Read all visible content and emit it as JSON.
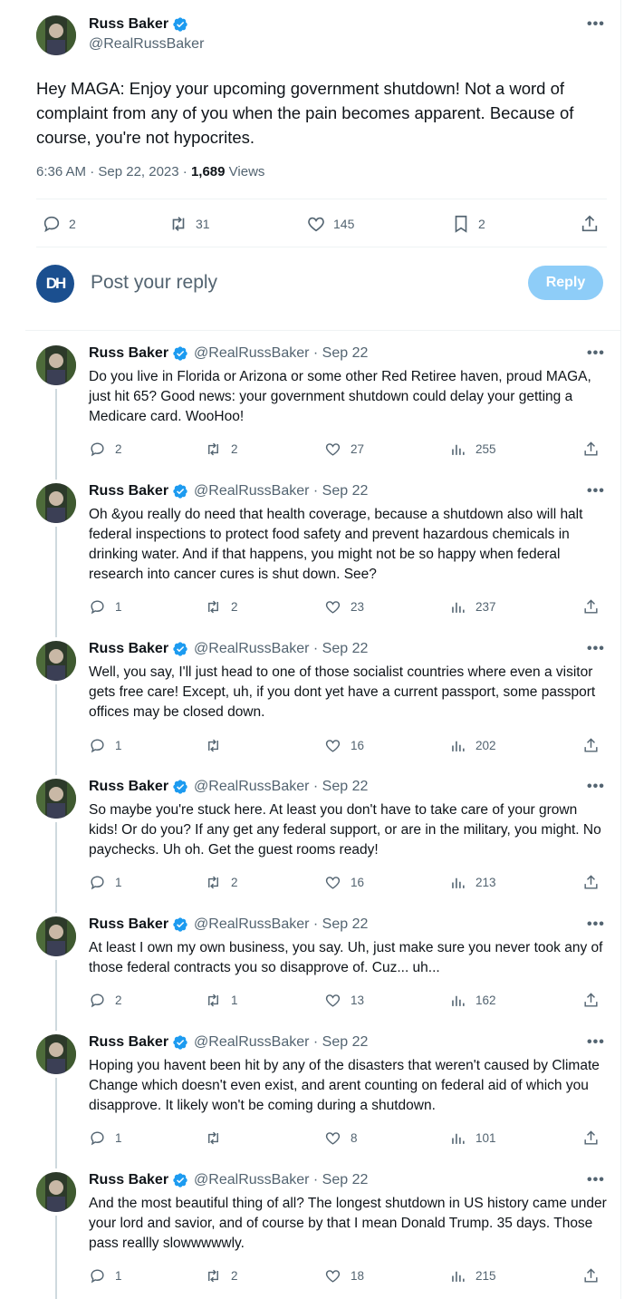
{
  "main_tweet": {
    "name": "Russ Baker",
    "handle": "@RealRussBaker",
    "text": "Hey MAGA: Enjoy your upcoming government shutdown! Not a word of complaint from any of you when the pain becomes apparent. Because of course, you're not hypocrites.",
    "time": "6:36 AM · Sep 22, 2023 · ",
    "views_count": "1,689",
    "views_label": " Views",
    "replies": "2",
    "retweets": "31",
    "likes": "145",
    "bookmarks": "2"
  },
  "reply_box": {
    "avatar_text": "DH",
    "placeholder": "Post your reply",
    "button": "Reply"
  },
  "colors": {
    "accent": "#1d9bf0",
    "reply_button": "#8ecdf8",
    "muted": "#536471",
    "dh_logo": "#1b4f8f"
  },
  "thread": [
    {
      "name": "Russ Baker",
      "handle": "@RealRussBaker · Sep 22",
      "text": "Do you live in Florida or Arizona or some other Red Retiree haven, proud MAGA, just hit 65? Good news: your government shutdown could delay your getting a Medicare card. WooHoo!",
      "replies": "2",
      "retweets": "2",
      "likes": "27",
      "views": "255"
    },
    {
      "name": "Russ Baker",
      "handle": "@RealRussBaker · Sep 22",
      "text": "Oh &you really do need that health coverage, because a shutdown also will halt federal inspections to protect food safety and prevent hazardous chemicals in drinking water. And if that happens, you might not be so happy when federal research into cancer cures is shut down. See?",
      "replies": "1",
      "retweets": "2",
      "likes": "23",
      "views": "237"
    },
    {
      "name": "Russ Baker",
      "handle": "@RealRussBaker · Sep 22",
      "text": "Well, you say, I'll just head to one of those socialist countries where even a visitor gets free care! Except, uh, if you dont yet have a current passport, some passport offices may be closed down.",
      "replies": "1",
      "retweets": "",
      "likes": "16",
      "views": "202"
    },
    {
      "name": "Russ Baker",
      "handle": "@RealRussBaker · Sep 22",
      "text": "So maybe you're stuck here. At least you don't have to take care of your grown kids! Or do you? If any get any federal support, or are in the military, you might. No paychecks. Uh oh. Get the guest rooms ready!",
      "replies": "1",
      "retweets": "2",
      "likes": "16",
      "views": "213"
    },
    {
      "name": "Russ Baker",
      "handle": "@RealRussBaker · Sep 22",
      "text": "At least I own my own business, you say. Uh, just make sure you never took any of those federal contracts you so disapprove of. Cuz... uh...",
      "replies": "2",
      "retweets": "1",
      "likes": "13",
      "views": "162"
    },
    {
      "name": "Russ Baker",
      "handle": "@RealRussBaker · Sep 22",
      "text": "Hoping you havent been hit by any of the disasters that weren't caused by Climate Change which doesn't even exist, and arent counting on federal aid of which you disapprove. It likely won't be coming during a shutdown.",
      "replies": "1",
      "retweets": "",
      "likes": "8",
      "views": "101"
    },
    {
      "name": "Russ Baker",
      "handle": "@RealRussBaker · Sep 22",
      "text": "And the most beautiful thing of all? The longest shutdown in US history came under your lord and savior, and of course by that I mean Donald Trump. 35 days. Those pass reallly slowwwwwly.",
      "replies": "1",
      "retweets": "2",
      "likes": "18",
      "views": "215"
    }
  ]
}
